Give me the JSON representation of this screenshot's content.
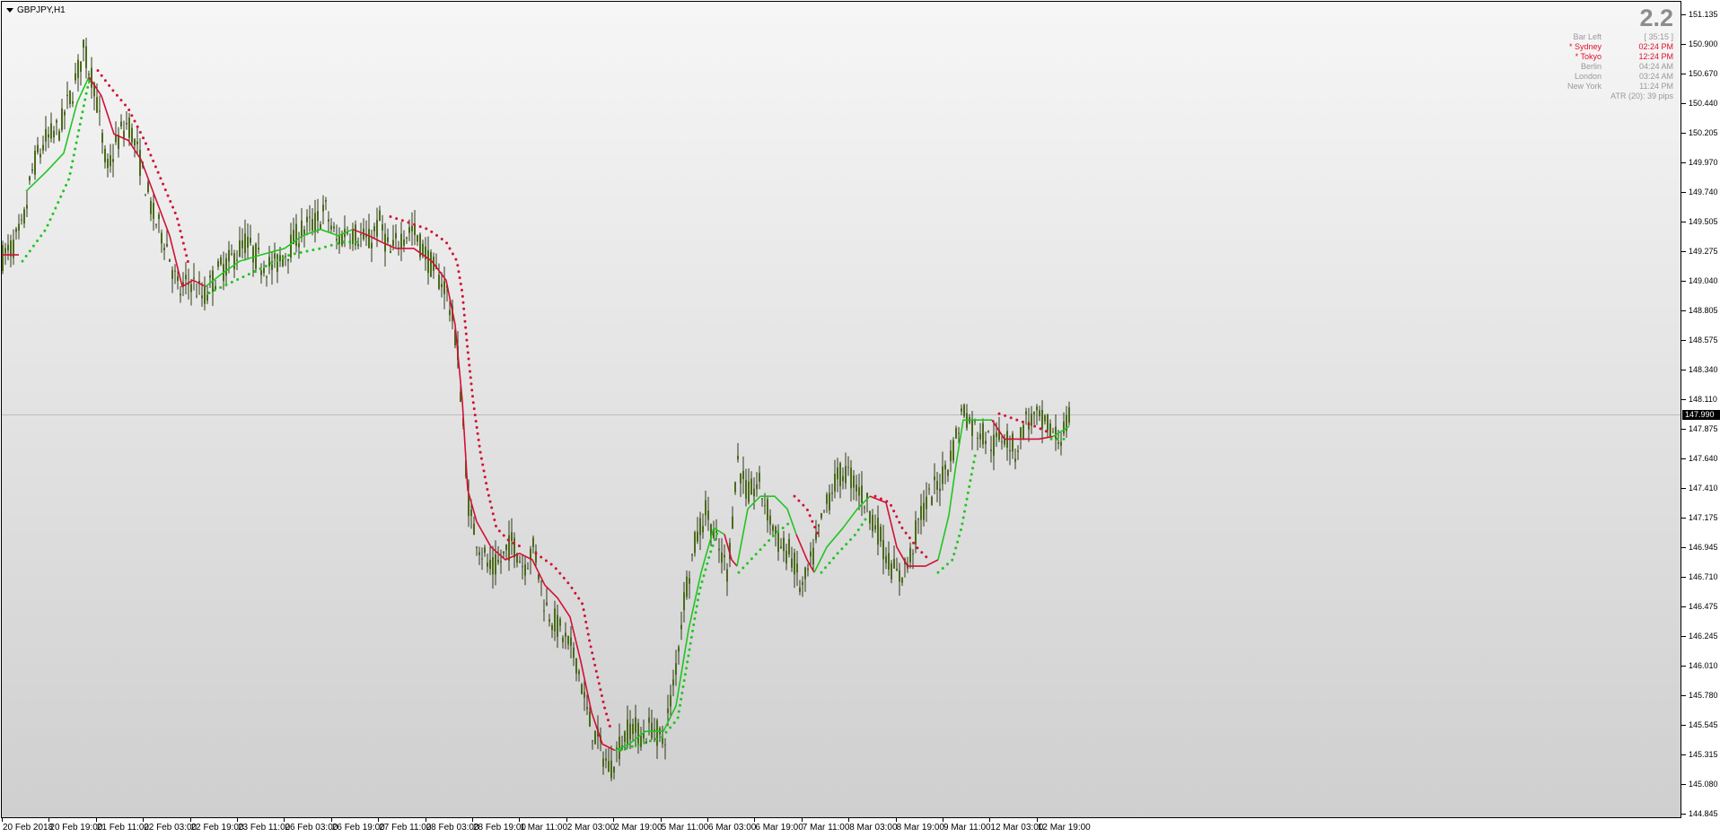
{
  "symbol": {
    "label": "GBPJPY,H1"
  },
  "info_panel": {
    "spread": "2.2",
    "rows": [
      {
        "label": "Bar Left",
        "value": "[ 35:15 ]",
        "highlight": false
      },
      {
        "label": "* Sydney",
        "value": "02:24 PM",
        "highlight": true
      },
      {
        "label": "* Tokyo",
        "value": "12:24 PM",
        "highlight": true
      },
      {
        "label": "Berlin",
        "value": "04:24 AM",
        "highlight": false
      },
      {
        "label": "London",
        "value": "03:24 AM",
        "highlight": false
      },
      {
        "label": "New York",
        "value": "11:24 PM",
        "highlight": false
      }
    ],
    "atr": "ATR (20): 39 pips"
  },
  "price_axis": {
    "labels": [
      "151.135",
      "150.900",
      "150.670",
      "150.440",
      "150.205",
      "149.970",
      "149.740",
      "149.505",
      "149.275",
      "149.040",
      "148.805",
      "148.575",
      "148.340",
      "148.110",
      "147.875",
      "147.640",
      "147.410",
      "147.175",
      "146.945",
      "146.710",
      "146.475",
      "146.245",
      "146.010",
      "145.780",
      "145.545",
      "145.315",
      "145.080",
      "144.845"
    ],
    "current_price": "147.990"
  },
  "time_axis": {
    "labels": [
      "20 Feb 2018",
      "20 Feb 19:00",
      "21 Feb 11:00",
      "22 Feb 03:00",
      "22 Feb 19:00",
      "23 Feb 11:00",
      "26 Feb 03:00",
      "26 Feb 19:00",
      "27 Feb 11:00",
      "28 Feb 03:00",
      "28 Feb 19:00",
      "1 Mar 11:00",
      "2 Mar 03:00",
      "2 Mar 19:00",
      "5 Mar 11:00",
      "6 Mar 03:00",
      "6 Mar 19:00",
      "7 Mar 11:00",
      "8 Mar 03:00",
      "8 Mar 19:00",
      "9 Mar 11:00",
      "12 Mar 03:00",
      "12 Mar 19:00"
    ]
  },
  "chart_data": {
    "type": "candlestick",
    "symbol": "GBPJPY",
    "timeframe": "H1",
    "ylim": [
      144.845,
      151.135
    ],
    "close_path": [
      [
        0,
        149.22
      ],
      [
        12,
        149.3
      ],
      [
        24,
        149.45
      ],
      [
        36,
        149.95
      ],
      [
        50,
        150.15
      ],
      [
        66,
        150.25
      ],
      [
        80,
        150.55
      ],
      [
        92,
        150.85
      ],
      [
        104,
        150.6
      ],
      [
        118,
        149.9
      ],
      [
        130,
        150.15
      ],
      [
        142,
        150.3
      ],
      [
        156,
        149.95
      ],
      [
        170,
        149.55
      ],
      [
        184,
        149.35
      ],
      [
        198,
        148.95
      ],
      [
        212,
        149.05
      ],
      [
        226,
        148.9
      ],
      [
        240,
        149.1
      ],
      [
        256,
        149.2
      ],
      [
        272,
        149.35
      ],
      [
        288,
        149.2
      ],
      [
        304,
        149.15
      ],
      [
        320,
        149.3
      ],
      [
        336,
        149.45
      ],
      [
        350,
        149.5
      ],
      [
        362,
        149.6
      ],
      [
        374,
        149.35
      ],
      [
        386,
        149.45
      ],
      [
        398,
        149.4
      ],
      [
        410,
        149.35
      ],
      [
        422,
        149.5
      ],
      [
        434,
        149.25
      ],
      [
        446,
        149.4
      ],
      [
        458,
        149.45
      ],
      [
        470,
        149.3
      ],
      [
        484,
        149.1
      ],
      [
        496,
        149.0
      ],
      [
        508,
        148.55
      ],
      [
        516,
        147.8
      ],
      [
        522,
        147.2
      ],
      [
        534,
        146.95
      ],
      [
        546,
        146.75
      ],
      [
        558,
        146.85
      ],
      [
        570,
        147.0
      ],
      [
        582,
        146.8
      ],
      [
        594,
        146.95
      ],
      [
        606,
        146.5
      ],
      [
        618,
        146.35
      ],
      [
        630,
        146.2
      ],
      [
        642,
        146.05
      ],
      [
        654,
        145.6
      ],
      [
        666,
        145.4
      ],
      [
        678,
        145.2
      ],
      [
        690,
        145.4
      ],
      [
        702,
        145.55
      ],
      [
        714,
        145.45
      ],
      [
        726,
        145.55
      ],
      [
        738,
        145.4
      ],
      [
        750,
        145.9
      ],
      [
        762,
        146.6
      ],
      [
        774,
        147.0
      ],
      [
        786,
        147.25
      ],
      [
        798,
        146.95
      ],
      [
        810,
        146.75
      ],
      [
        820,
        147.65
      ],
      [
        832,
        147.35
      ],
      [
        844,
        147.45
      ],
      [
        856,
        147.2
      ],
      [
        868,
        146.95
      ],
      [
        880,
        146.9
      ],
      [
        892,
        146.6
      ],
      [
        904,
        146.85
      ],
      [
        916,
        147.2
      ],
      [
        928,
        147.45
      ],
      [
        940,
        147.55
      ],
      [
        952,
        147.45
      ],
      [
        964,
        147.3
      ],
      [
        976,
        147.1
      ],
      [
        988,
        146.85
      ],
      [
        1000,
        146.7
      ],
      [
        1012,
        146.85
      ],
      [
        1024,
        147.2
      ],
      [
        1036,
        147.35
      ],
      [
        1048,
        147.5
      ],
      [
        1060,
        147.7
      ],
      [
        1072,
        148.05
      ],
      [
        1082,
        147.9
      ],
      [
        1094,
        147.85
      ],
      [
        1106,
        147.75
      ],
      [
        1118,
        147.85
      ],
      [
        1130,
        147.7
      ],
      [
        1142,
        147.95
      ],
      [
        1154,
        147.95
      ],
      [
        1166,
        147.9
      ],
      [
        1178,
        147.8
      ],
      [
        1190,
        147.95
      ]
    ],
    "indicators": [
      {
        "name": "",
        "color": "#d21034",
        "style": "solid",
        "points": [
          [
            0,
            149.25
          ],
          [
            20,
            149.25
          ]
        ]
      },
      {
        "name": "",
        "color": "#22c422",
        "style": "solid",
        "points": [
          [
            28,
            149.75
          ],
          [
            50,
            149.9
          ],
          [
            70,
            150.05
          ],
          [
            85,
            150.45
          ],
          [
            98,
            150.65
          ]
        ]
      },
      {
        "name": "",
        "color": "#d21034",
        "style": "solid",
        "points": [
          [
            98,
            150.65
          ],
          [
            112,
            150.5
          ],
          [
            126,
            150.2
          ],
          [
            142,
            150.15
          ],
          [
            156,
            150.0
          ],
          [
            172,
            149.7
          ],
          [
            188,
            149.4
          ],
          [
            202,
            149.0
          ],
          [
            214,
            149.05
          ],
          [
            228,
            149.0
          ]
        ]
      },
      {
        "name": "",
        "color": "#22c422",
        "style": "solid",
        "points": [
          [
            228,
            149.0
          ],
          [
            246,
            149.1
          ],
          [
            266,
            149.2
          ],
          [
            290,
            149.25
          ],
          [
            316,
            149.3
          ],
          [
            336,
            149.4
          ],
          [
            356,
            149.45
          ],
          [
            376,
            149.4
          ],
          [
            392,
            149.45
          ]
        ]
      },
      {
        "name": "",
        "color": "#d21034",
        "style": "solid",
        "points": [
          [
            392,
            149.45
          ],
          [
            410,
            149.4
          ],
          [
            424,
            149.35
          ],
          [
            440,
            149.3
          ],
          [
            460,
            149.3
          ],
          [
            480,
            149.2
          ],
          [
            496,
            149.05
          ],
          [
            506,
            148.7
          ],
          [
            514,
            148.1
          ],
          [
            520,
            147.4
          ],
          [
            530,
            147.15
          ],
          [
            546,
            146.95
          ],
          [
            562,
            146.85
          ],
          [
            578,
            146.9
          ],
          [
            592,
            146.85
          ],
          [
            606,
            146.65
          ],
          [
            620,
            146.55
          ],
          [
            634,
            146.4
          ],
          [
            646,
            146.05
          ],
          [
            658,
            145.65
          ],
          [
            670,
            145.4
          ],
          [
            684,
            145.35
          ]
        ]
      },
      {
        "name": "",
        "color": "#22c422",
        "style": "solid",
        "points": [
          [
            684,
            145.35
          ],
          [
            700,
            145.4
          ],
          [
            718,
            145.5
          ],
          [
            738,
            145.5
          ],
          [
            752,
            145.7
          ],
          [
            766,
            146.3
          ],
          [
            780,
            146.75
          ],
          [
            794,
            147.1
          ],
          [
            806,
            147.05
          ]
        ]
      },
      {
        "name": "",
        "color": "#d21034",
        "style": "solid",
        "points": [
          [
            806,
            147.05
          ],
          [
            814,
            146.85
          ],
          [
            820,
            146.8
          ]
        ]
      },
      {
        "name": "",
        "color": "#22c422",
        "style": "solid",
        "points": [
          [
            820,
            146.8
          ],
          [
            832,
            147.25
          ],
          [
            846,
            147.35
          ],
          [
            862,
            147.35
          ],
          [
            876,
            147.25
          ],
          [
            886,
            147.05
          ]
        ]
      },
      {
        "name": "",
        "color": "#d21034",
        "style": "solid",
        "points": [
          [
            886,
            147.05
          ],
          [
            898,
            146.85
          ],
          [
            906,
            146.75
          ]
        ]
      },
      {
        "name": "",
        "color": "#22c422",
        "style": "solid",
        "points": [
          [
            906,
            146.75
          ],
          [
            920,
            146.95
          ],
          [
            938,
            147.1
          ],
          [
            954,
            147.25
          ],
          [
            968,
            147.35
          ]
        ]
      },
      {
        "name": "",
        "color": "#d21034",
        "style": "solid",
        "points": [
          [
            968,
            147.35
          ],
          [
            986,
            147.3
          ],
          [
            998,
            146.95
          ],
          [
            1010,
            146.8
          ],
          [
            1030,
            146.8
          ],
          [
            1044,
            146.85
          ]
        ]
      },
      {
        "name": "",
        "color": "#22c422",
        "style": "solid",
        "points": [
          [
            1044,
            146.85
          ],
          [
            1056,
            147.2
          ],
          [
            1064,
            147.6
          ],
          [
            1072,
            147.95
          ],
          [
            1090,
            147.95
          ],
          [
            1104,
            147.95
          ]
        ]
      },
      {
        "name": "",
        "color": "#d21034",
        "style": "solid",
        "points": [
          [
            1104,
            147.95
          ],
          [
            1118,
            147.8
          ],
          [
            1136,
            147.8
          ],
          [
            1156,
            147.8
          ],
          [
            1172,
            147.82
          ]
        ]
      },
      {
        "name": "",
        "color": "#22c422",
        "style": "solid",
        "points": [
          [
            1172,
            147.82
          ],
          [
            1190,
            147.9
          ]
        ]
      },
      {
        "name": "",
        "color": "#22c422",
        "style": "dotted",
        "points": [
          [
            24,
            149.2
          ],
          [
            50,
            149.45
          ],
          [
            76,
            149.85
          ],
          [
            96,
            150.55
          ],
          [
            100,
            150.65
          ]
        ]
      },
      {
        "name": "",
        "color": "#d21034",
        "style": "dotted",
        "points": [
          [
            108,
            150.7
          ],
          [
            124,
            150.55
          ],
          [
            142,
            150.4
          ],
          [
            160,
            150.15
          ],
          [
            178,
            149.85
          ],
          [
            196,
            149.55
          ],
          [
            210,
            149.15
          ]
        ]
      },
      {
        "name": "",
        "color": "#22c422",
        "style": "dotted",
        "points": [
          [
            232,
            148.95
          ],
          [
            262,
            149.05
          ],
          [
            292,
            149.15
          ],
          [
            322,
            149.25
          ],
          [
            356,
            149.3
          ],
          [
            380,
            149.35
          ],
          [
            398,
            149.35
          ]
        ]
      },
      {
        "name": "",
        "color": "#d21034",
        "style": "dotted",
        "points": [
          [
            434,
            149.55
          ],
          [
            456,
            149.5
          ],
          [
            476,
            149.45
          ],
          [
            496,
            149.35
          ],
          [
            508,
            149.2
          ],
          [
            514,
            148.95
          ],
          [
            520,
            148.5
          ],
          [
            526,
            148.1
          ],
          [
            534,
            147.7
          ],
          [
            542,
            147.4
          ],
          [
            552,
            147.1
          ],
          [
            566,
            147.0
          ],
          [
            580,
            146.95
          ]
        ]
      },
      {
        "name": "",
        "color": "#d21034",
        "style": "dotted",
        "points": [
          [
            596,
            146.9
          ],
          [
            616,
            146.8
          ],
          [
            634,
            146.65
          ],
          [
            648,
            146.5
          ],
          [
            656,
            146.2
          ],
          [
            664,
            145.95
          ],
          [
            672,
            145.7
          ],
          [
            680,
            145.5
          ]
        ]
      },
      {
        "name": "",
        "color": "#22c422",
        "style": "dotted",
        "points": [
          [
            690,
            145.35
          ],
          [
            712,
            145.4
          ],
          [
            736,
            145.45
          ],
          [
            754,
            145.6
          ],
          [
            766,
            146.1
          ],
          [
            778,
            146.6
          ],
          [
            790,
            146.9
          ],
          [
            800,
            147.1
          ]
        ]
      },
      {
        "name": "",
        "color": "#22c422",
        "style": "dotted",
        "points": [
          [
            822,
            146.75
          ],
          [
            842,
            146.9
          ],
          [
            862,
            147.05
          ],
          [
            880,
            147.15
          ]
        ]
      },
      {
        "name": "",
        "color": "#d21034",
        "style": "dotted",
        "points": [
          [
            884,
            147.35
          ],
          [
            898,
            147.25
          ],
          [
            910,
            147.05
          ]
        ]
      },
      {
        "name": "",
        "color": "#22c422",
        "style": "dotted",
        "points": [
          [
            914,
            146.75
          ],
          [
            932,
            146.9
          ],
          [
            952,
            147.05
          ],
          [
            966,
            147.2
          ]
        ]
      },
      {
        "name": "",
        "color": "#d21034",
        "style": "dotted",
        "points": [
          [
            974,
            147.35
          ],
          [
            990,
            147.3
          ],
          [
            1004,
            147.1
          ],
          [
            1020,
            146.95
          ],
          [
            1034,
            146.85
          ]
        ]
      },
      {
        "name": "",
        "color": "#22c422",
        "style": "dotted",
        "points": [
          [
            1044,
            146.75
          ],
          [
            1060,
            146.85
          ],
          [
            1070,
            147.1
          ],
          [
            1078,
            147.4
          ],
          [
            1086,
            147.7
          ]
        ]
      },
      {
        "name": "",
        "color": "#d21034",
        "style": "dotted",
        "points": [
          [
            1112,
            148.0
          ],
          [
            1132,
            147.95
          ],
          [
            1152,
            147.9
          ],
          [
            1168,
            147.85
          ]
        ]
      },
      {
        "name": "",
        "color": "#22c422",
        "style": "dotted",
        "points": [
          [
            1170,
            147.8
          ],
          [
            1190,
            147.8
          ]
        ]
      }
    ]
  },
  "colors": {
    "candle_body": "#4a6b1a",
    "candle_wick": "#2e3a14",
    "bull": "#22c422",
    "bear": "#d21034"
  }
}
